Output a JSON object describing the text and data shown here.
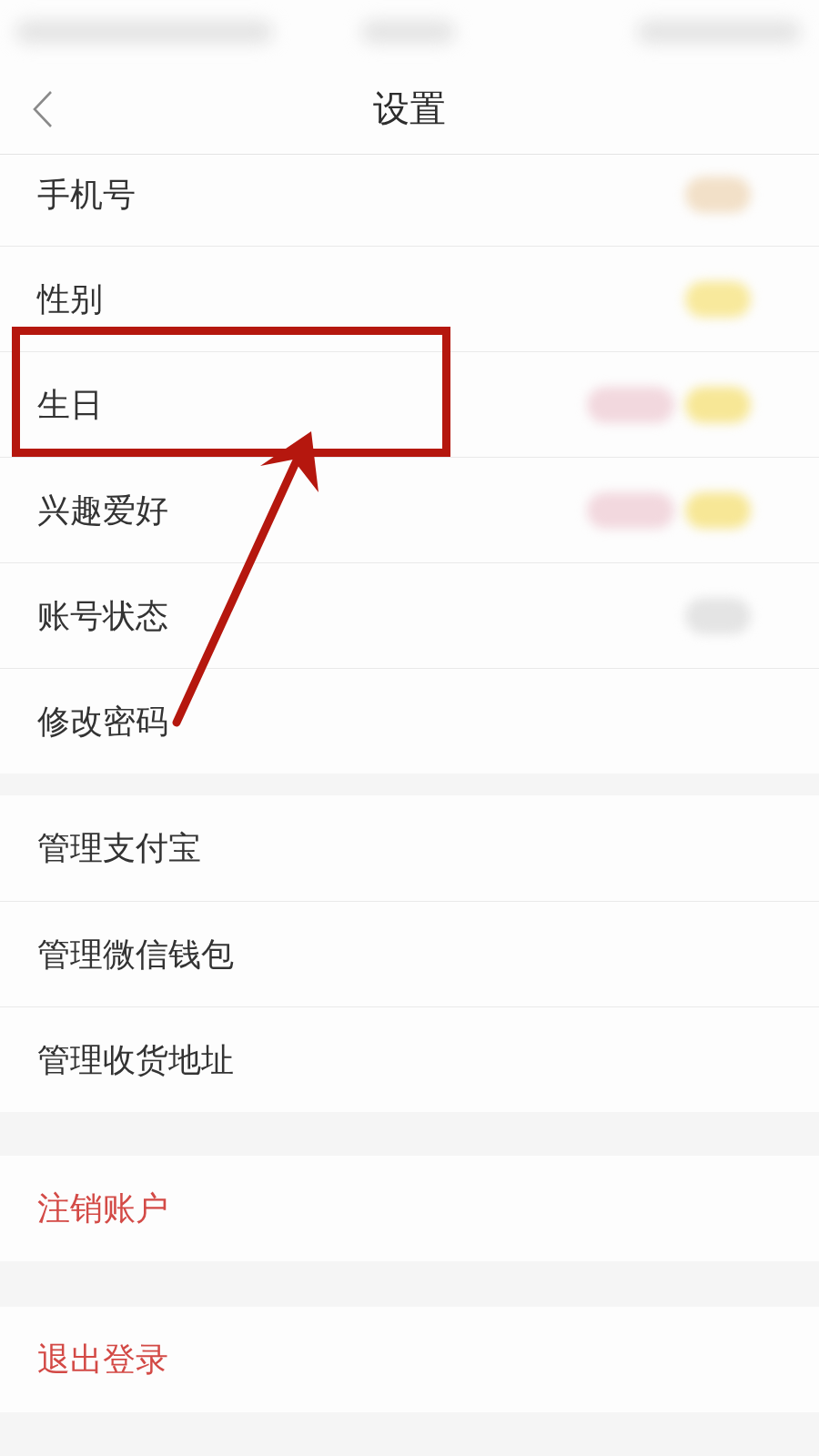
{
  "status_bar": {
    "blurred": true
  },
  "header": {
    "title": "设置"
  },
  "sections": [
    {
      "items": [
        {
          "label": "手机号",
          "kind": "normal",
          "highlighted": false,
          "blurred_values": [
            {
              "color": "#f2e0c8"
            }
          ]
        },
        {
          "label": "性别",
          "kind": "normal",
          "highlighted": false,
          "blurred_values": [
            {
              "color": "#f8e99c"
            }
          ]
        },
        {
          "label": "生日",
          "kind": "normal",
          "highlighted": true,
          "blurred_values": [
            {
              "color": "#f2d8de"
            },
            {
              "color": "#f7e796"
            }
          ]
        },
        {
          "label": "兴趣爱好",
          "kind": "normal",
          "highlighted": false,
          "blurred_values": [
            {
              "color": "#f2d8de"
            },
            {
              "color": "#f7e796"
            }
          ]
        },
        {
          "label": "账号状态",
          "kind": "normal",
          "highlighted": false,
          "blurred_values": [
            {
              "color": "#e4e4e4"
            }
          ]
        },
        {
          "label": "修改密码",
          "kind": "normal",
          "highlighted": false
        }
      ]
    },
    {
      "items": [
        {
          "label": "管理支付宝",
          "kind": "normal",
          "highlighted": false
        },
        {
          "label": "管理微信钱包",
          "kind": "normal",
          "highlighted": false
        },
        {
          "label": "管理收货地址",
          "kind": "normal",
          "highlighted": false
        }
      ]
    },
    {
      "items": [
        {
          "label": "注销账户",
          "kind": "danger",
          "highlighted": false
        }
      ]
    },
    {
      "items": [
        {
          "label": "退出登录",
          "kind": "danger",
          "highlighted": false
        }
      ]
    }
  ]
}
